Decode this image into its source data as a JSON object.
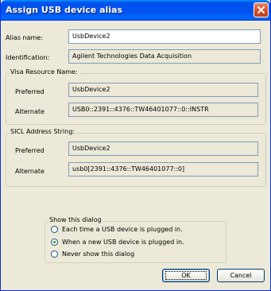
{
  "window": {
    "title": "Assign USB device alias"
  },
  "alias": {
    "label": "Alias name:",
    "value": "UsbDevice2"
  },
  "identification": {
    "label": "Identification:",
    "value": "Agilent Technologies Data Acquisition"
  },
  "visa": {
    "group_title": "Visa Resource Name:",
    "preferred_label": "Preferred",
    "preferred_value": "UsbDevice2",
    "alternate_label": "Alternate",
    "alternate_value": "USB0::2391::4376::TW46401077::0::INSTR"
  },
  "sicl": {
    "group_title": "SICL Address String:",
    "preferred_label": "Preferred",
    "preferred_value": "UsbDevice2",
    "alternate_label": "Alternate",
    "alternate_value": "usb0[2391::4376::TW46401077::0]"
  },
  "show_dialog": {
    "group_title": "Show this dialog",
    "options": [
      {
        "label": "Each time a USB device is plugged in."
      },
      {
        "label": "When a new USB device is plugged in."
      },
      {
        "label": "Never show this dialog"
      }
    ],
    "selected": "When a new USB device is plugged in."
  },
  "buttons": {
    "ok": "OK",
    "cancel": "Cancel"
  },
  "colors": {
    "title_bar": "#0053ee",
    "face": "#ece9d8",
    "field_border": "#7f9db9"
  }
}
